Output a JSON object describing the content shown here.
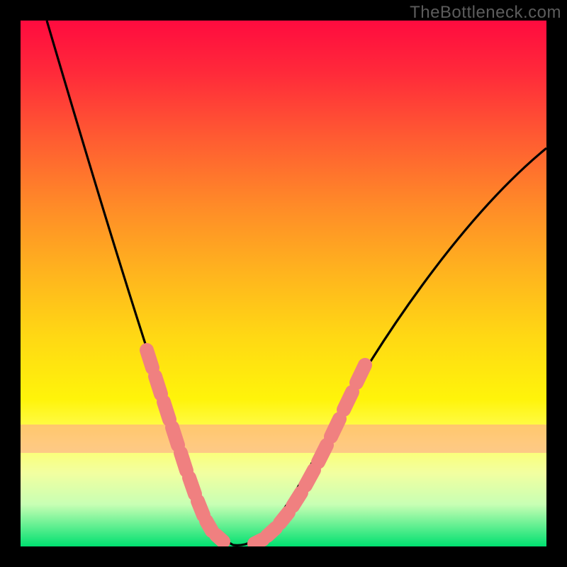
{
  "watermark": "TheBottleneck.com",
  "chart_data": {
    "type": "line",
    "title": "",
    "xlabel": "",
    "ylabel": "",
    "xlim": [
      0,
      100
    ],
    "ylim": [
      0,
      100
    ],
    "series": [
      {
        "name": "bottleneck-curve",
        "x": [
          5,
          10,
          15,
          20,
          24,
          27,
          30,
          33,
          36,
          38,
          45,
          55,
          65,
          75,
          85,
          95,
          100
        ],
        "y": [
          100,
          84,
          68,
          52,
          38,
          27,
          16,
          8,
          3,
          0,
          0,
          8,
          22,
          38,
          55,
          70,
          77
        ]
      }
    ],
    "overlay_points": {
      "name": "highlight-segments",
      "color": "#f08080",
      "points": [
        {
          "x": 22,
          "y": 46
        },
        {
          "x": 23.5,
          "y": 40
        },
        {
          "x": 25,
          "y": 33
        },
        {
          "x": 26.5,
          "y": 27
        },
        {
          "x": 28,
          "y": 20
        },
        {
          "x": 29.5,
          "y": 14
        },
        {
          "x": 31,
          "y": 9
        },
        {
          "x": 32.5,
          "y": 5
        },
        {
          "x": 34,
          "y": 2
        },
        {
          "x": 44,
          "y": 0
        },
        {
          "x": 46,
          "y": 0.5
        },
        {
          "x": 48,
          "y": 2
        },
        {
          "x": 50,
          "y": 4
        },
        {
          "x": 52,
          "y": 7
        },
        {
          "x": 54,
          "y": 11
        },
        {
          "x": 56,
          "y": 15
        },
        {
          "x": 58,
          "y": 19
        }
      ]
    },
    "gradient_stops": [
      {
        "pos": 0,
        "color": "#ff0b3f"
      },
      {
        "pos": 45,
        "color": "#ffb41e"
      },
      {
        "pos": 80,
        "color": "#ffff66"
      },
      {
        "pos": 100,
        "color": "#00e070"
      }
    ]
  }
}
